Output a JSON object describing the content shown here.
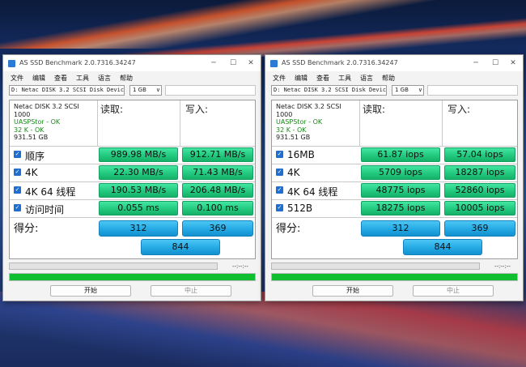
{
  "windows": [
    {
      "title": "AS SSD Benchmark 2.0.7316.34247",
      "menu": [
        "文件",
        "编辑",
        "查看",
        "工具",
        "语言",
        "帮助"
      ],
      "drive_select": "D: Netac DISK 3.2 SCSI Disk Devic",
      "size_select": "1 GB",
      "info": [
        "Netac DISK 3.2 SCSI",
        "1000",
        "UASPStor - OK",
        "32 K - OK",
        "931.51 GB"
      ],
      "read_header": "读取:",
      "write_header": "写入:",
      "rows": [
        {
          "label": "顺序",
          "read": "989.98 MB/s",
          "write": "912.71 MB/s"
        },
        {
          "label": "4K",
          "read": "22.30 MB/s",
          "write": "71.43 MB/s"
        },
        {
          "label": "4K 64 线程",
          "read": "190.53 MB/s",
          "write": "206.48 MB/s"
        },
        {
          "label": "访问时间",
          "read": "0.055 ms",
          "write": "0.100 ms"
        }
      ],
      "score_label": "得分:",
      "score_read": "312",
      "score_write": "369",
      "score_total": "844",
      "time_readout": "--:--:--",
      "progress_complete": 1.0,
      "start_label": "开始",
      "stop_label": "中止"
    },
    {
      "title": "AS SSD Benchmark 2.0.7316.34247",
      "menu": [
        "文件",
        "编辑",
        "查看",
        "工具",
        "语言",
        "帮助"
      ],
      "drive_select": "D: Netac DISK 3.2 SCSI Disk Devic",
      "size_select": "1 GB",
      "info": [
        "Netac DISK 3.2 SCSI",
        "1000",
        "UASPStor - OK",
        "32 K - OK",
        "931.51 GB"
      ],
      "read_header": "读取:",
      "write_header": "写入:",
      "rows": [
        {
          "label": "16MB",
          "read": "61.87 iops",
          "write": "57.04 iops"
        },
        {
          "label": "4K",
          "read": "5709 iops",
          "write": "18287 iops"
        },
        {
          "label": "4K 64 线程",
          "read": "48775 iops",
          "write": "52860 iops"
        },
        {
          "label": "512B",
          "read": "18275 iops",
          "write": "10005 iops"
        }
      ],
      "score_label": "得分:",
      "score_read": "312",
      "score_write": "369",
      "score_total": "844",
      "time_readout": "--:--:--",
      "progress_complete": 1.0,
      "start_label": "开始",
      "stop_label": "中止"
    }
  ]
}
